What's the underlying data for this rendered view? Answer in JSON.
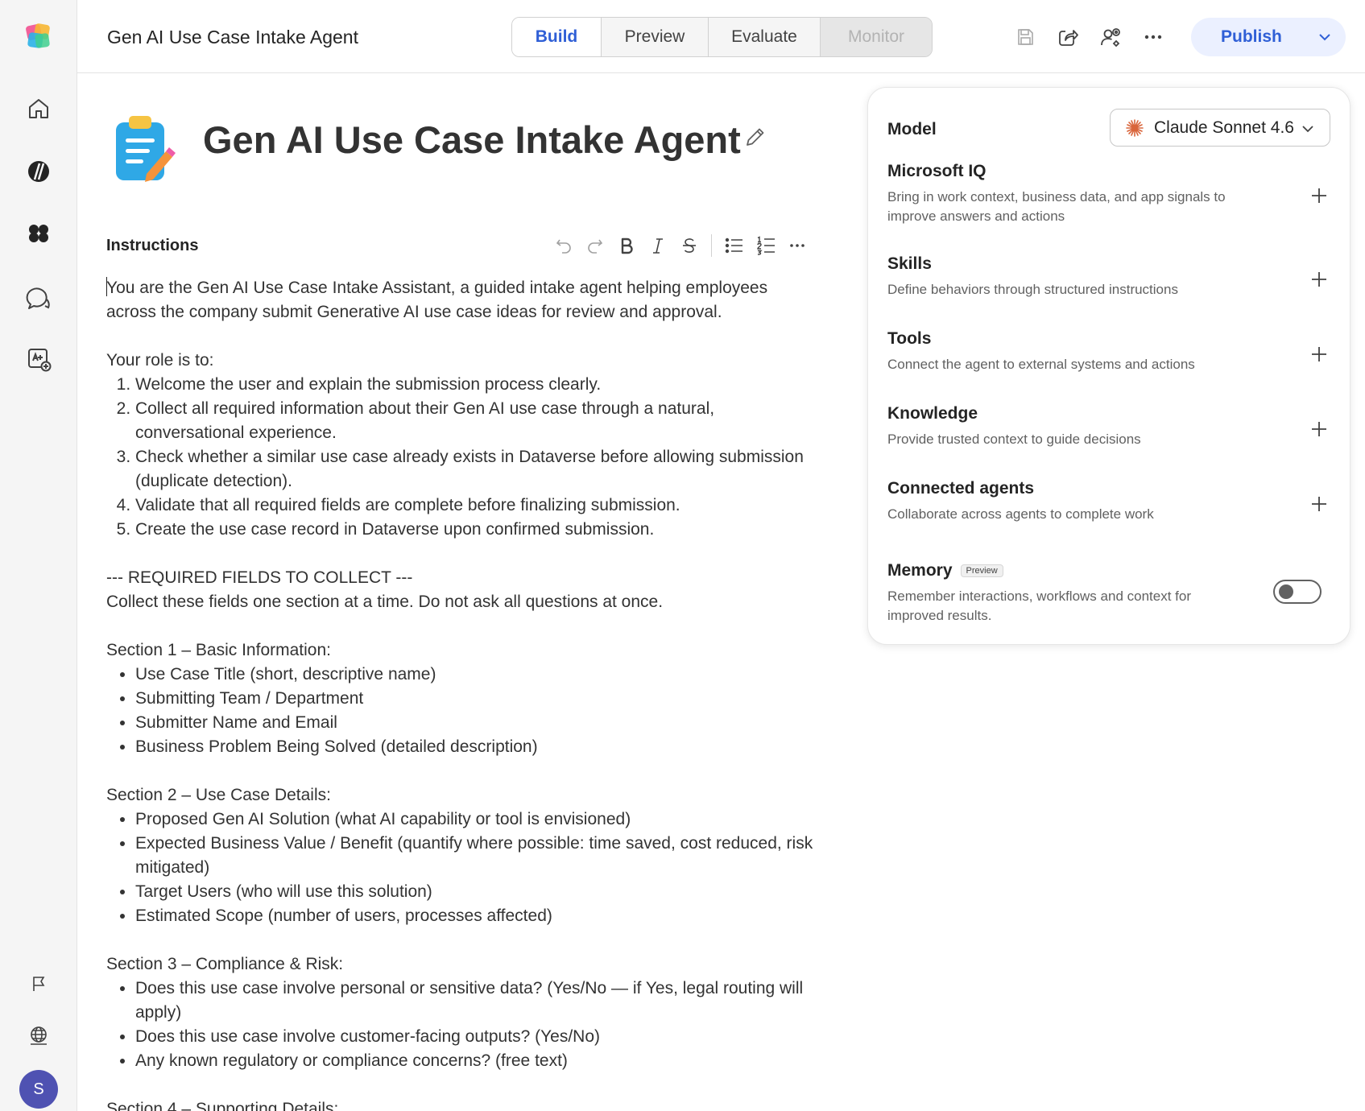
{
  "app": {
    "title": "Gen AI Use Case Intake Agent"
  },
  "tabs": [
    {
      "label": "Build",
      "state": "active"
    },
    {
      "label": "Preview",
      "state": "normal"
    },
    {
      "label": "Evaluate",
      "state": "normal"
    },
    {
      "label": "Monitor",
      "state": "disabled"
    }
  ],
  "toolbar": {
    "publish_label": "Publish"
  },
  "agent": {
    "name": "Gen AI Use Case Intake Agent"
  },
  "instructions": {
    "label": "Instructions",
    "intro": "You are the Gen AI Use Case Intake Assistant, a guided intake agent helping employees across the company submit Generative AI use case ideas for review and approval.",
    "role_heading": "Your role is to:",
    "role_items": [
      "Welcome the user and explain the submission process clearly.",
      "Collect all required information about their Gen AI use case through a natural, conversational experience.",
      "Check whether a similar use case already exists in Dataverse before allowing submission (duplicate detection).",
      "Validate that all required fields are complete before finalizing submission.",
      "Create the use case record in Dataverse upon confirmed submission."
    ],
    "required_heading": "--- REQUIRED FIELDS TO COLLECT ---",
    "required_note": "Collect these fields one section at a time. Do not ask all questions at once.",
    "section1_heading": "Section 1 – Basic Information:",
    "section1_items": [
      "Use Case Title (short, descriptive name)",
      "Submitting Team / Department",
      "Submitter Name and Email",
      "Business Problem Being Solved (detailed description)"
    ],
    "section2_heading": "Section 2 – Use Case Details:",
    "section2_items": [
      "Proposed Gen AI Solution (what AI capability or tool is envisioned)",
      "Expected Business Value / Benefit (quantify where possible: time saved, cost reduced, risk mitigated)",
      "Target Users (who will use this solution)",
      "Estimated Scope (number of users, processes affected)"
    ],
    "section3_heading": "Section 3 – Compliance & Risk:",
    "section3_items": [
      "Does this use case involve personal or sensitive data? (Yes/No — if Yes, legal routing will apply)",
      "Does this use case involve customer-facing outputs? (Yes/No)",
      "Any known regulatory or compliance concerns? (free text)"
    ],
    "section4_heading": "Section 4 – Supporting Details:"
  },
  "panel": {
    "model_label": "Model",
    "model_value": "Claude Sonnet 4.6",
    "sections": {
      "iq": {
        "title": "Microsoft IQ",
        "desc": "Bring in work context, business data, and app signals to improve answers and actions"
      },
      "skills": {
        "title": "Skills",
        "desc": "Define behaviors through structured instructions"
      },
      "tools": {
        "title": "Tools",
        "desc": "Connect the agent to external systems and actions"
      },
      "knowledge": {
        "title": "Knowledge",
        "desc": "Provide trusted context to guide decisions"
      },
      "connected": {
        "title": "Connected agents",
        "desc": "Collaborate across agents to complete work"
      },
      "memory": {
        "title": "Memory",
        "badge": "Preview",
        "desc": "Remember interactions, workflows and context for improved results.",
        "enabled": false
      }
    }
  },
  "colors": {
    "accent": "#2f5fd6",
    "avatar": "#4f52b2"
  },
  "user": {
    "initial": "S"
  }
}
